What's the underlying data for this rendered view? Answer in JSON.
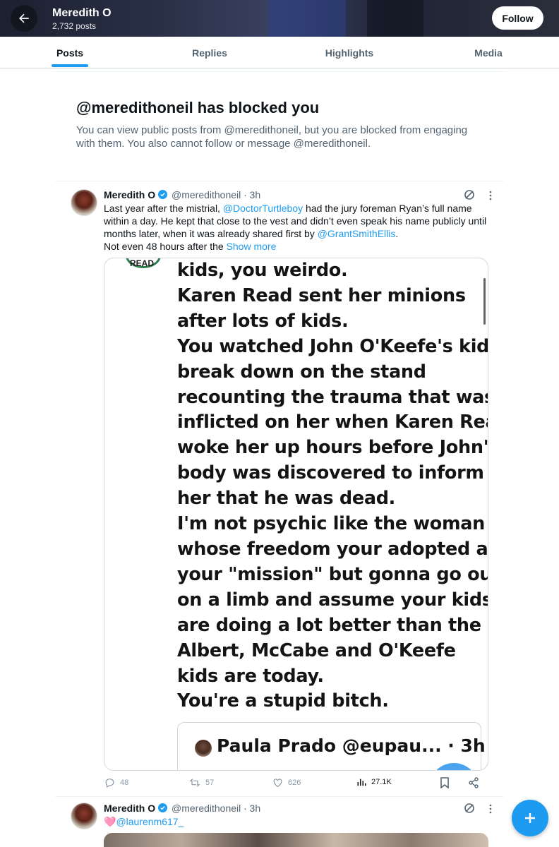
{
  "header": {
    "name": "Meredith O",
    "post_count": "2,732 posts",
    "follow_label": "Follow"
  },
  "tabs": [
    {
      "label": "Posts",
      "active": true
    },
    {
      "label": "Replies",
      "active": false
    },
    {
      "label": "Highlights",
      "active": false
    },
    {
      "label": "Media",
      "active": false
    }
  ],
  "blocked": {
    "title": "@meredithoneil has blocked you",
    "description": "You can view public posts from @meredithoneil, but you are blocked from engaging with them. You also cannot follow or message @meredithoneil."
  },
  "post1": {
    "name": "Meredith O",
    "handle": "@meredithoneil",
    "time": "· 3h",
    "text_1": "Last year after the mistrial, ",
    "mention_1": "@DoctorTurtleboy",
    "text_2": " had the jury foreman Ryan’s full name within a day. He kept that close to the vest and didn’t even speak his name publicly until months later, when it was already shared first by ",
    "mention_2": "@GrantSmithEllis",
    "text_3": ".",
    "text_4": "Not even 48 hours after the ",
    "show_more": "Show more",
    "media": {
      "logo_text": "READ",
      "text": "kids, you weirdo.\nKaren Read sent her minions\nafter lots of kids.\nYou watched John O'Keefe's kid\nbreak down on the stand\nrecounting the trauma that was\ninflicted on her when Karen Read\nwoke her up hours before John's\nbody was discovered to inform\nher that he was dead.\nI'm not psychic like the woman\nwhose freedom your adopted as\nyour \"mission\" but gonna go out\non a limb and assume your kids\nare doing a lot better than the\nAlbert, McCabe and O'Keefe\nkids are today.\nYou're a stupid bitch.",
      "quote_name": "Paula Prado @eupau... · 3h"
    },
    "stats": {
      "replies": "48",
      "reposts": "57",
      "likes": "626",
      "views": "27.1K"
    }
  },
  "post2": {
    "name": "Meredith O",
    "handle": "@meredithoneil",
    "time": "· 3h",
    "emoji": "🩷",
    "mention": "@laurenm617_"
  },
  "colors": {
    "accent": "#1d9bf0",
    "secondary_text": "#536471"
  },
  "icons": [
    "back-arrow-icon",
    "verified-icon",
    "grok-icon",
    "more-icon",
    "reply-icon",
    "repost-icon",
    "like-icon",
    "views-icon",
    "bookmark-icon",
    "share-icon",
    "compose-plus-icon"
  ]
}
